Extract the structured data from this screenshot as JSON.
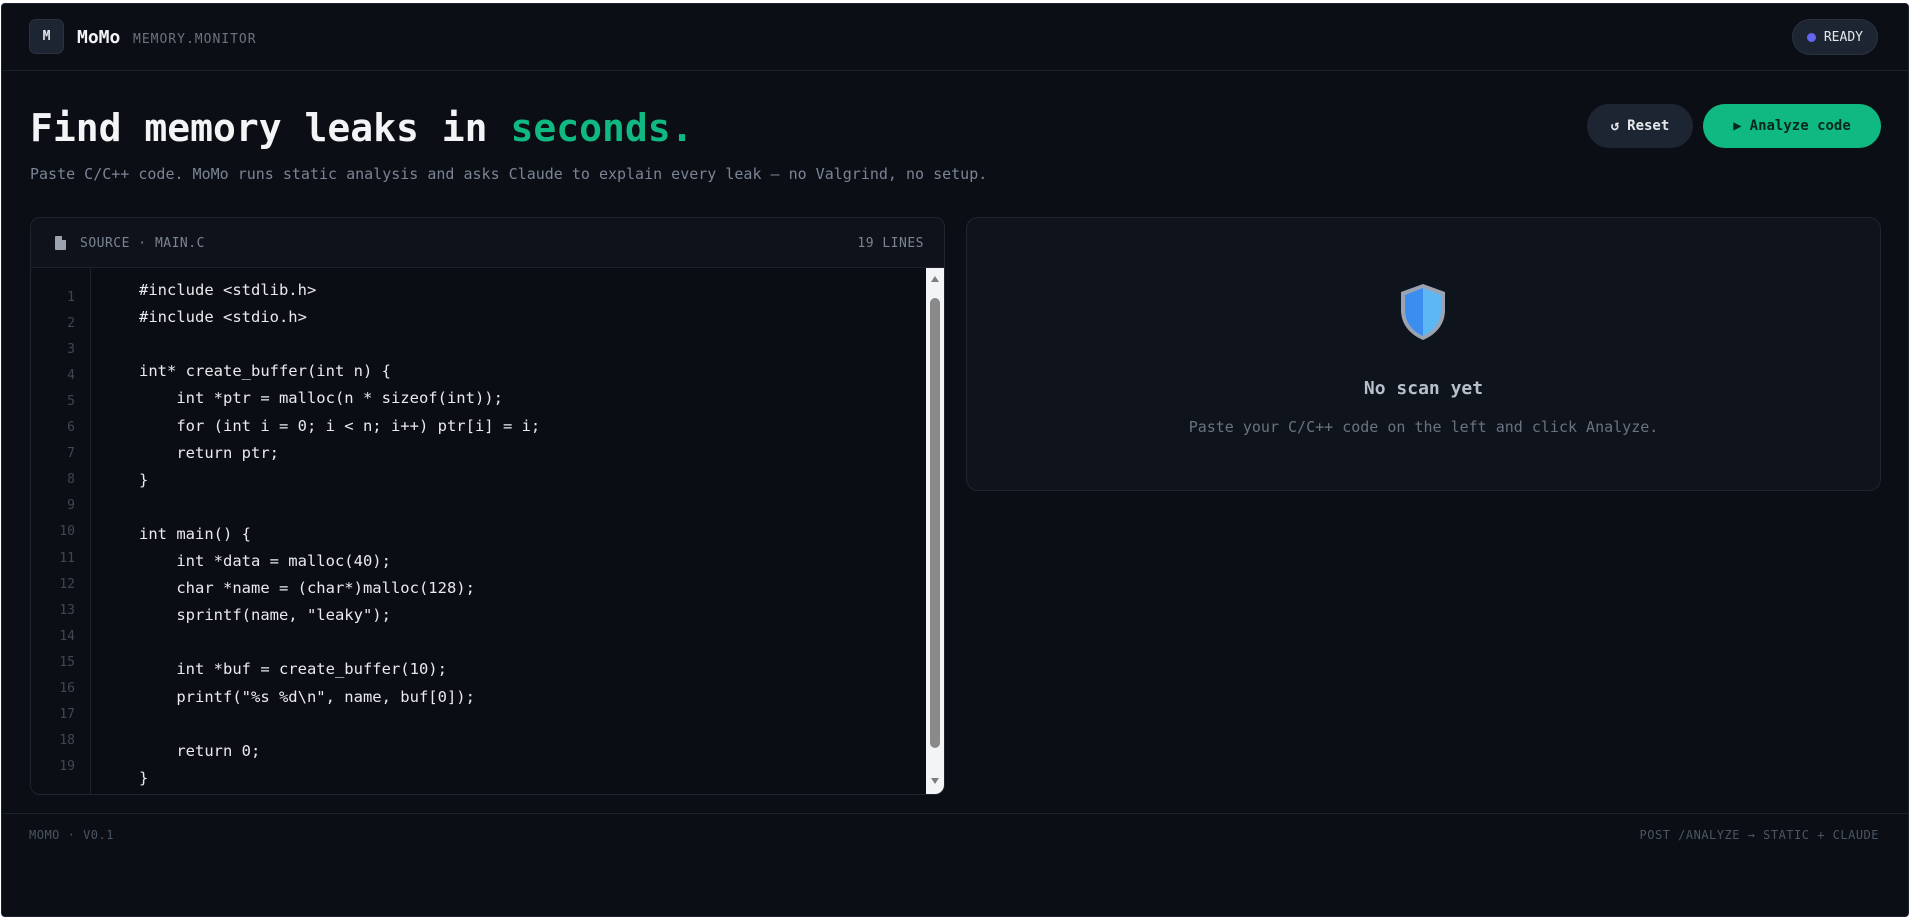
{
  "header": {
    "logo_letter": "M",
    "brand_name": "MoMo",
    "brand_sub": "MEMORY.MONITOR",
    "status": "READY"
  },
  "hero": {
    "headline_main": "Find memory leaks in ",
    "headline_accent": "seconds.",
    "subline": "Paste C/C++ code. MoMo runs static analysis and asks Claude to explain every leak — no Valgrind, no setup."
  },
  "actions": {
    "reset_label": "Reset",
    "analyze_label": "Analyze code"
  },
  "editor": {
    "title": "SOURCE · MAIN.C",
    "line_count": "19 LINES",
    "line_numbers": [
      "1",
      "2",
      "3",
      "4",
      "5",
      "6",
      "7",
      "8",
      "9",
      "10",
      "11",
      "12",
      "13",
      "14",
      "15",
      "16",
      "17",
      "18",
      "19"
    ],
    "code": [
      "#include <stdlib.h>",
      "#include <stdio.h>",
      "",
      "int* create_buffer(int n) {",
      "    int *ptr = malloc(n * sizeof(int));",
      "    for (int i = 0; i < n; i++) ptr[i] = i;",
      "    return ptr;",
      "}",
      "",
      "int main() {",
      "    int *data = malloc(40);",
      "    char *name = (char*)malloc(128);",
      "    sprintf(name, \"leaky\");",
      "",
      "    int *buf = create_buffer(10);",
      "    printf(\"%s %d\\n\", name, buf[0]);",
      "",
      "    return 0;",
      "}"
    ]
  },
  "results": {
    "icon": "shield-icon",
    "empty_title": "No scan yet",
    "empty_hint": "Paste your C/C++ code on the left and click Analyze."
  },
  "footer": {
    "left": "MOMO · V0.1",
    "right": "POST /ANALYZE → STATIC + CLAUDE"
  },
  "colors": {
    "background": "#0b0e15",
    "accent": "#10b981",
    "status_dot": "#6366f1"
  }
}
